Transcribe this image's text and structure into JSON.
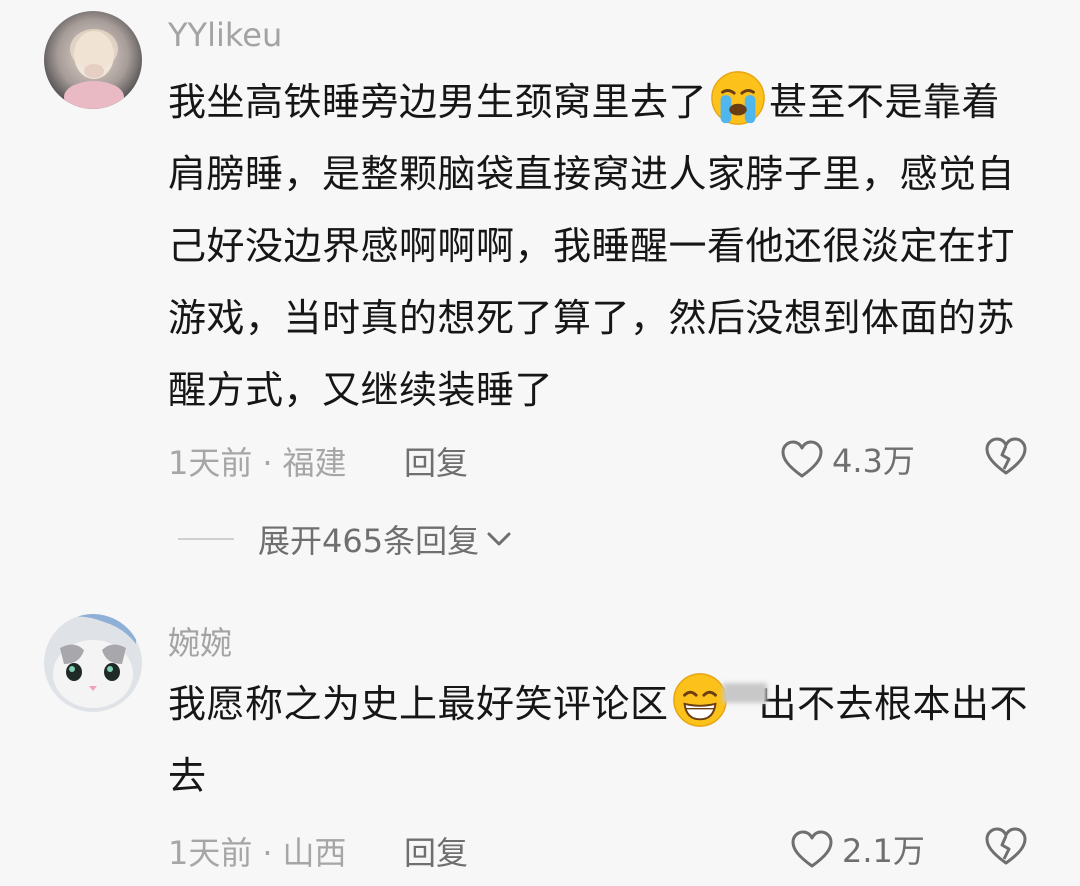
{
  "comments": [
    {
      "username": "YYlikeu",
      "text_segments": [
        "我坐高铁睡旁边男生颈窝里去了",
        "甚至不是靠着肩膀睡，是整颗脑袋直接窝进人家脖子里，感觉自己好没边界感啊啊啊，我睡醒一看他还很淡定在打游戏，当时真的想死了算了，然后没想到体面的苏醒方式，又继续装睡了"
      ],
      "emoji": "loudly-crying-face",
      "time": "1天前",
      "location": "福建",
      "reply_label": "回复",
      "likes": "4.3万"
    },
    {
      "username": "婉婉",
      "text_segments": [
        "我愿称之为史上最好笑评论区",
        "出不去根本出不去"
      ],
      "emoji": "grinning-squinting-face",
      "time": "1天前",
      "location": "山西",
      "reply_label": "回复",
      "likes": "2.1万"
    }
  ],
  "expand_replies": "展开465条回复",
  "colors": {
    "background": "#f7f7f7",
    "text": "#161616",
    "muted": "#a6a6a6",
    "action": "#6f6f6f"
  }
}
